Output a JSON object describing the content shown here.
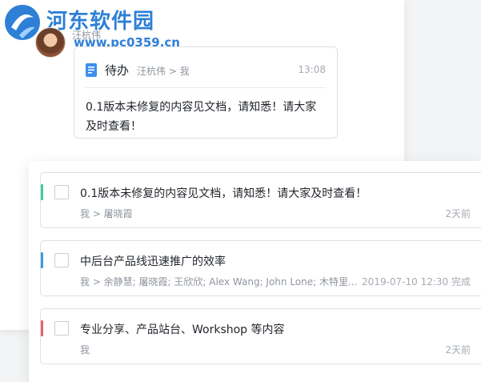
{
  "watermark": {
    "title": "河东软件园",
    "url": "www.pc0359.cn"
  },
  "chat": {
    "sender_name": "汪杭伟",
    "card": {
      "icon": "todo-doc-icon",
      "title": "待办",
      "route": "汪杭伟 > 我",
      "time": "13:08",
      "body": "0.1版本未修复的内容见文档，请知悉！请大家及时查看！"
    }
  },
  "tasks": [
    {
      "color": "#3ecf9a",
      "title": "0.1版本未修复的内容见文档，请知悉！请大家及时查看！",
      "meta": "我 > 屠晓霞",
      "time": "2天前"
    },
    {
      "color": "#3a9be0",
      "title": "中后台产品线迅速推广的效率",
      "meta": "我 > 余静慧; 屠晓霞; 王欣欣; Alex Wang; John Lone; 木特里...",
      "time": "2019-07-10 12:30 完成"
    },
    {
      "color": "#e8606f",
      "title": "专业分享、产品站台、Workshop 等内容",
      "meta": "我",
      "time": "2天前"
    }
  ]
}
